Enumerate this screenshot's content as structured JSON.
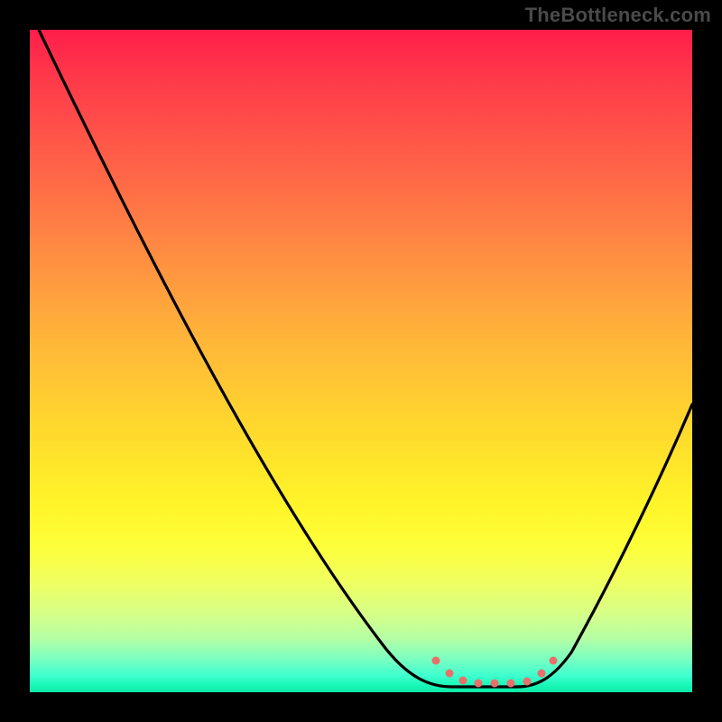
{
  "watermark": "TheBottleneck.com",
  "chart_data": {
    "type": "line",
    "title": "",
    "xlabel": "",
    "ylabel": "",
    "xlim": [
      0,
      100
    ],
    "ylim": [
      0,
      100
    ],
    "background": "vertical-heat-gradient (red top → green bottom)",
    "series": [
      {
        "name": "bottleneck-curve",
        "x": [
          1,
          10,
          20,
          30,
          40,
          50,
          55,
          60,
          63,
          66,
          70,
          74,
          78,
          82,
          88,
          94,
          100
        ],
        "y": [
          100,
          84,
          68,
          53,
          39,
          24,
          16,
          9,
          4,
          1,
          0,
          0,
          1,
          5,
          18,
          32,
          44
        ]
      }
    ],
    "annotations": [
      {
        "name": "optimal-range-dotted-marker",
        "color": "#e9706a",
        "x_range": [
          61,
          79
        ],
        "y": 2,
        "style": "dotted-band"
      }
    ],
    "grid": false,
    "legend": false
  },
  "colors": {
    "frame": "#000000",
    "curve": "#000000",
    "marker": "#e9706a",
    "watermark": "#4a4a4a",
    "gradient_top": "#ff1e4a",
    "gradient_bottom": "#0ee8a4"
  }
}
